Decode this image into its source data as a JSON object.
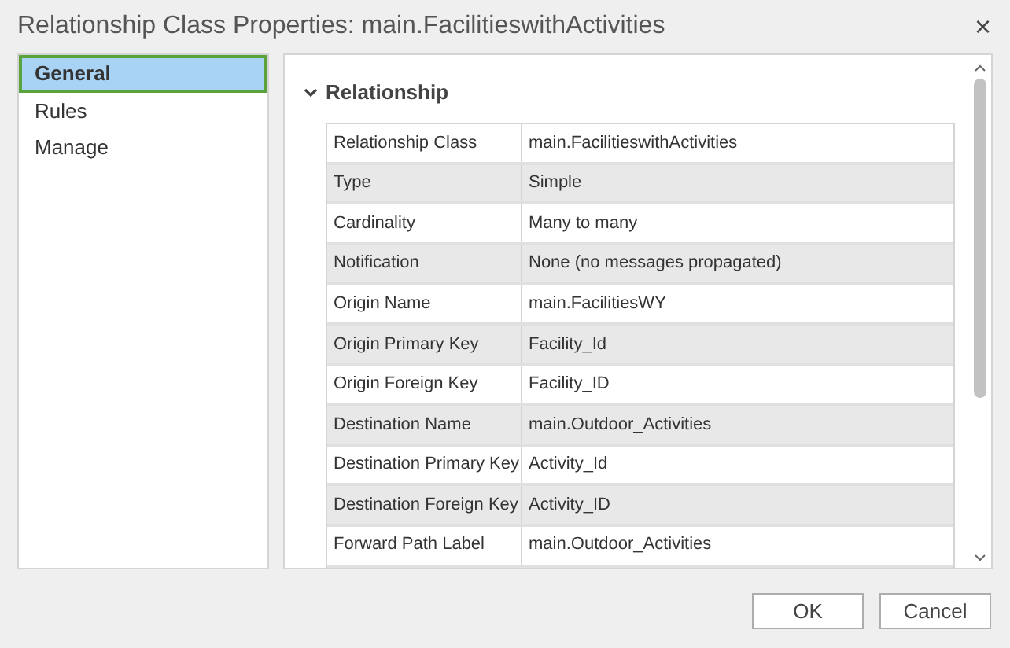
{
  "window": {
    "title": "Relationship Class Properties: main.FacilitieswithActivities",
    "close": "×"
  },
  "sidebar": {
    "items": [
      {
        "label": "General",
        "selected": true
      },
      {
        "label": "Rules",
        "selected": false
      },
      {
        "label": "Manage",
        "selected": false
      }
    ]
  },
  "section": {
    "title": "Relationship",
    "expanded": true
  },
  "table": {
    "rows": [
      [
        "Relationship Class",
        "main.FacilitieswithActivities"
      ],
      [
        "Type",
        "Simple"
      ],
      [
        "Cardinality",
        "Many to many"
      ],
      [
        "Notification",
        "None (no messages propagated)"
      ],
      [
        "Origin Name",
        "main.FacilitiesWY"
      ],
      [
        "Origin Primary Key",
        "Facility_Id"
      ],
      [
        "Origin Foreign Key",
        "Facility_ID"
      ],
      [
        "Destination Name",
        "main.Outdoor_Activities"
      ],
      [
        "Destination Primary Key",
        "Activity_Id"
      ],
      [
        "Destination Foreign Key",
        "Activity_ID"
      ],
      [
        "Forward Path Label",
        "main.Outdoor_Activities"
      ]
    ]
  },
  "buttons": [
    "OK",
    "Cancel"
  ]
}
